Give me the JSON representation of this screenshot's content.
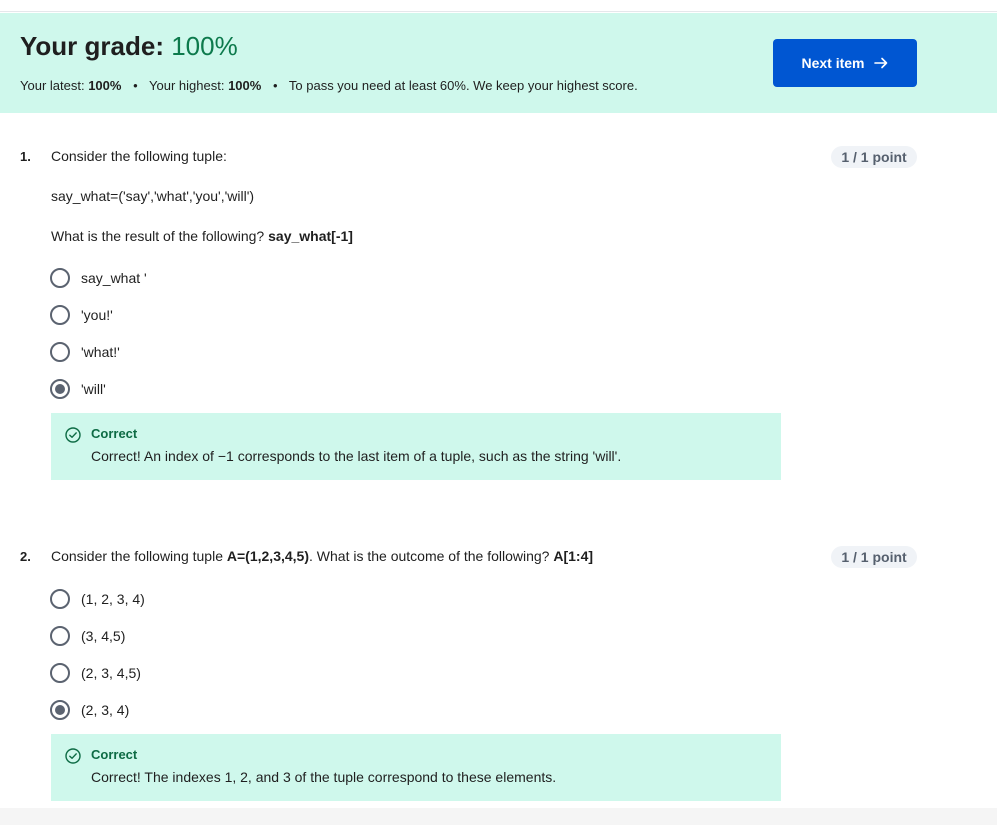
{
  "grade": {
    "title": "Your grade:",
    "percent": "100%",
    "latest_label": "Your latest:",
    "latest_value": "100%",
    "highest_label": "Your highest:",
    "highest_value": "100%",
    "pass_note": "To pass you need at least 60%. We keep your highest score.",
    "separator": "•"
  },
  "next_button": {
    "label": "Next item",
    "icon": "arrow-right-icon"
  },
  "questions": [
    {
      "number": "1.",
      "prompt": "Consider the following tuple:",
      "code": "say_what=('say','what','you','will')",
      "question_prefix": "What is the result of the following?",
      "question_bold": "say_what[-1]",
      "points": "1 / 1 point",
      "options": [
        {
          "label": "say_what '",
          "selected": false
        },
        {
          "label": "'you!'",
          "selected": false
        },
        {
          "label": "'what!'",
          "selected": false
        },
        {
          "label": "'will'",
          "selected": true
        }
      ],
      "feedback": {
        "title": "Correct",
        "text": "Correct! An index of −1 corresponds to the last item of a tuple, such as the string 'will'.",
        "icon": "check-circle-icon"
      }
    },
    {
      "number": "2.",
      "prompt_prefix": "Consider the following tuple",
      "prompt_bold": "A=(1,2,3,4,5)",
      "prompt_mid": ". What is the outcome of the following?",
      "prompt_bold2": "A[1:4]",
      "points": "1 / 1 point",
      "options": [
        {
          "label": "(1, 2, 3, 4)",
          "selected": false
        },
        {
          "label": "(3, 4,5)",
          "selected": false
        },
        {
          "label": "(2, 3, 4,5)",
          "selected": false
        },
        {
          "label": "(2, 3, 4)",
          "selected": true
        }
      ],
      "feedback": {
        "title": "Correct",
        "text": "Correct! The indexes 1, 2, and 3 of the tuple correspond to these elements.",
        "icon": "check-circle-icon"
      }
    }
  ],
  "colors": {
    "banner_bg": "#cff8ec",
    "accent_blue": "#0056d2",
    "success_green": "#0d7a4c"
  }
}
